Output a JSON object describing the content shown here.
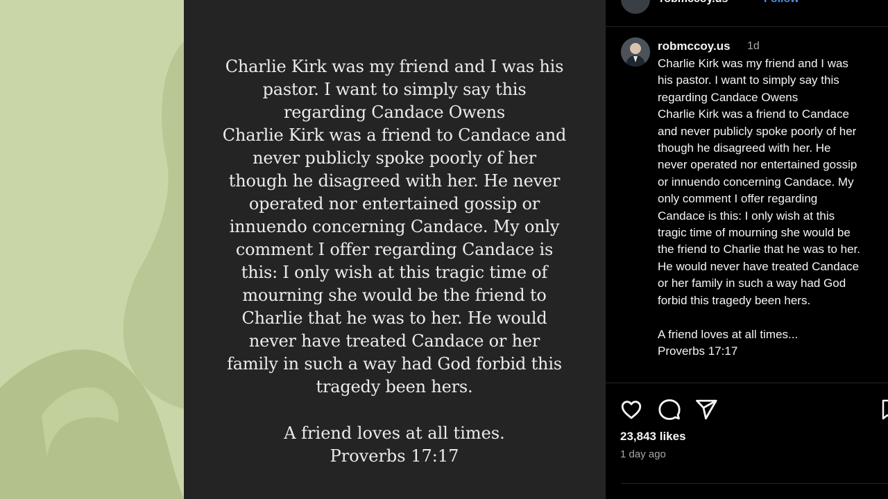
{
  "post_image": {
    "body": "Charlie Kirk was my friend and I was his\npastor. I want to simply say this\nregarding Candace Owens\nCharlie Kirk was a friend to Candace and\nnever publicly spoke poorly of her\nthough he disagreed with her. He never\noperated nor entertained gossip or\ninnuendo concerning Candace. My only\ncomment I offer regarding Candace is\nthis: I only wish at this tragic time of\nmourning she would be the friend to\nCharlie that he was to her. He would\nnever have treated Candace or her\nfamily in such a way had God forbid this\ntragedy been hers.",
    "footer": "A friend loves at all times.\nProverbs 17:17"
  },
  "header": {
    "username": "robmccoy.us",
    "follow_label": "• Follow"
  },
  "caption": {
    "username": "robmccoy.us",
    "time": "1d",
    "body": "Charlie Kirk was my friend and I was\nhis pastor. I want to simply say this\nregarding Candace Owens\nCharlie Kirk was a friend to Candace\nand never publicly spoke poorly of her\nthough he disagreed with her. He\nnever operated nor entertained gossip\nor innuendo concerning Candace. My\nonly comment I offer regarding\nCandace is this: I only wish at this\ntragic time of mourning she would be\nthe friend to Charlie that he was to her.\nHe would never have treated Candace\nor her family in such a way had God\nforbid this tragedy been hers.\n\nA friend loves at all times...\nProverbs 17:17"
  },
  "actions": {
    "icons": [
      "heart-icon",
      "comment-icon",
      "share-icon",
      "bookmark-icon"
    ]
  },
  "stats": {
    "likes": "23,843 likes",
    "posted": "1 day ago"
  },
  "colors": {
    "background_panel": "#c9d6a8",
    "post_card": "#242424",
    "side_bg": "#000000",
    "link_blue": "#4a90e2"
  }
}
